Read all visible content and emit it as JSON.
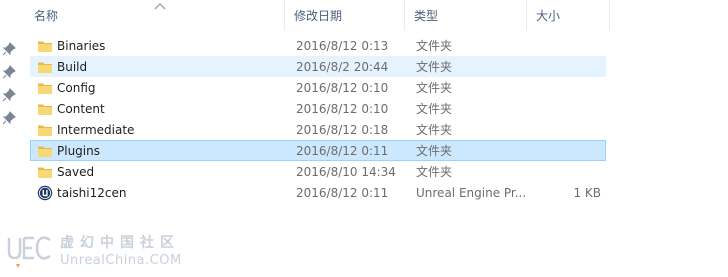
{
  "columns": {
    "name": "名称",
    "date": "修改日期",
    "type": "类型",
    "size": "大小"
  },
  "rows": [
    {
      "icon": "folder-icon",
      "name": "Binaries",
      "date": "2016/8/12 0:13",
      "type": "文件夹",
      "size": "",
      "state": "normal"
    },
    {
      "icon": "folder-icon",
      "name": "Build",
      "date": "2016/8/2 20:44",
      "type": "文件夹",
      "size": "",
      "state": "hover"
    },
    {
      "icon": "folder-icon",
      "name": "Config",
      "date": "2016/8/12 0:10",
      "type": "文件夹",
      "size": "",
      "state": "normal"
    },
    {
      "icon": "folder-icon",
      "name": "Content",
      "date": "2016/8/12 0:10",
      "type": "文件夹",
      "size": "",
      "state": "normal"
    },
    {
      "icon": "folder-icon",
      "name": "Intermediate",
      "date": "2016/8/12 0:18",
      "type": "文件夹",
      "size": "",
      "state": "normal"
    },
    {
      "icon": "folder-icon",
      "name": "Plugins",
      "date": "2016/8/12 0:11",
      "type": "文件夹",
      "size": "",
      "state": "selected"
    },
    {
      "icon": "folder-icon",
      "name": "Saved",
      "date": "2016/8/10 14:34",
      "type": "文件夹",
      "size": "",
      "state": "normal"
    },
    {
      "icon": "unreal-project-icon",
      "name": "taishi12cen",
      "date": "2016/8/12 0:11",
      "type": "Unreal Engine Pr...",
      "size": "1 KB",
      "state": "normal"
    }
  ],
  "watermark": {
    "cn": "虚幻中国社区",
    "en": "UnrealChina.COM"
  },
  "colors": {
    "hover": "#e5f3ff",
    "selected": "#cce8ff",
    "selected_border": "#99d1ff",
    "folder": "#f8d775"
  }
}
